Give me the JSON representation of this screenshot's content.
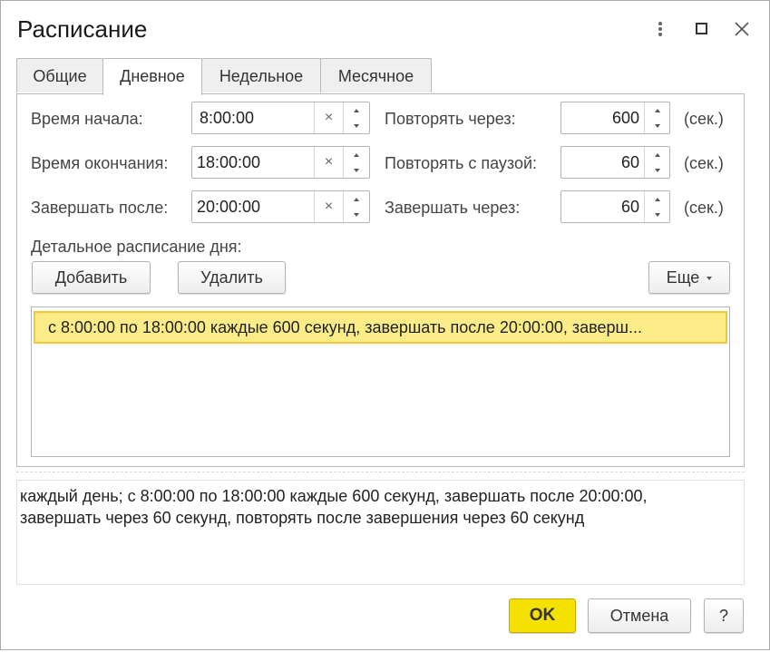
{
  "window": {
    "title": "Расписание",
    "controls": [
      "more-icon",
      "maximize-icon",
      "close-icon"
    ]
  },
  "tabs": [
    {
      "label": "Общие",
      "active": false
    },
    {
      "label": "Дневное",
      "active": true
    },
    {
      "label": "Недельное",
      "active": false
    },
    {
      "label": "Месячное",
      "active": false
    }
  ],
  "daily": {
    "start_time": {
      "label": "Время начала:",
      "value": "8:00:00"
    },
    "end_time": {
      "label": "Время окончания:",
      "value": "18:00:00"
    },
    "complete_after": {
      "label": "Завершать после:",
      "value": "20:00:00"
    },
    "repeat_every": {
      "label": "Повторять через:",
      "value": "600",
      "unit": "(сек.)"
    },
    "repeat_pause": {
      "label": "Повторять с паузой:",
      "value": "60",
      "unit": "(сек.)"
    },
    "complete_in": {
      "label": "Завершать через:",
      "value": "60",
      "unit": "(сек.)"
    },
    "clear_glyph": "×",
    "detail_label": "Детальное расписание дня:",
    "add_label": "Добавить",
    "delete_label": "Удалить",
    "more_label": "Еще",
    "rows": [
      "с 8:00:00 по 18:00:00 каждые 600 секунд, завершать после 20:00:00, заверш..."
    ]
  },
  "description": {
    "line1": "каждый день; с 8:00:00 по 18:00:00 каждые 600 секунд, завершать после 20:00:00,",
    "line2": "завершать через 60 секунд, повторять после завершения через 60 секунд"
  },
  "footer": {
    "ok_label": "OK",
    "cancel_label": "Отмена",
    "help_label": "?"
  },
  "colors": {
    "selected_row_bg": "#fbec88",
    "selected_row_border": "#f0c83a",
    "ok_button": "#f5e100"
  }
}
